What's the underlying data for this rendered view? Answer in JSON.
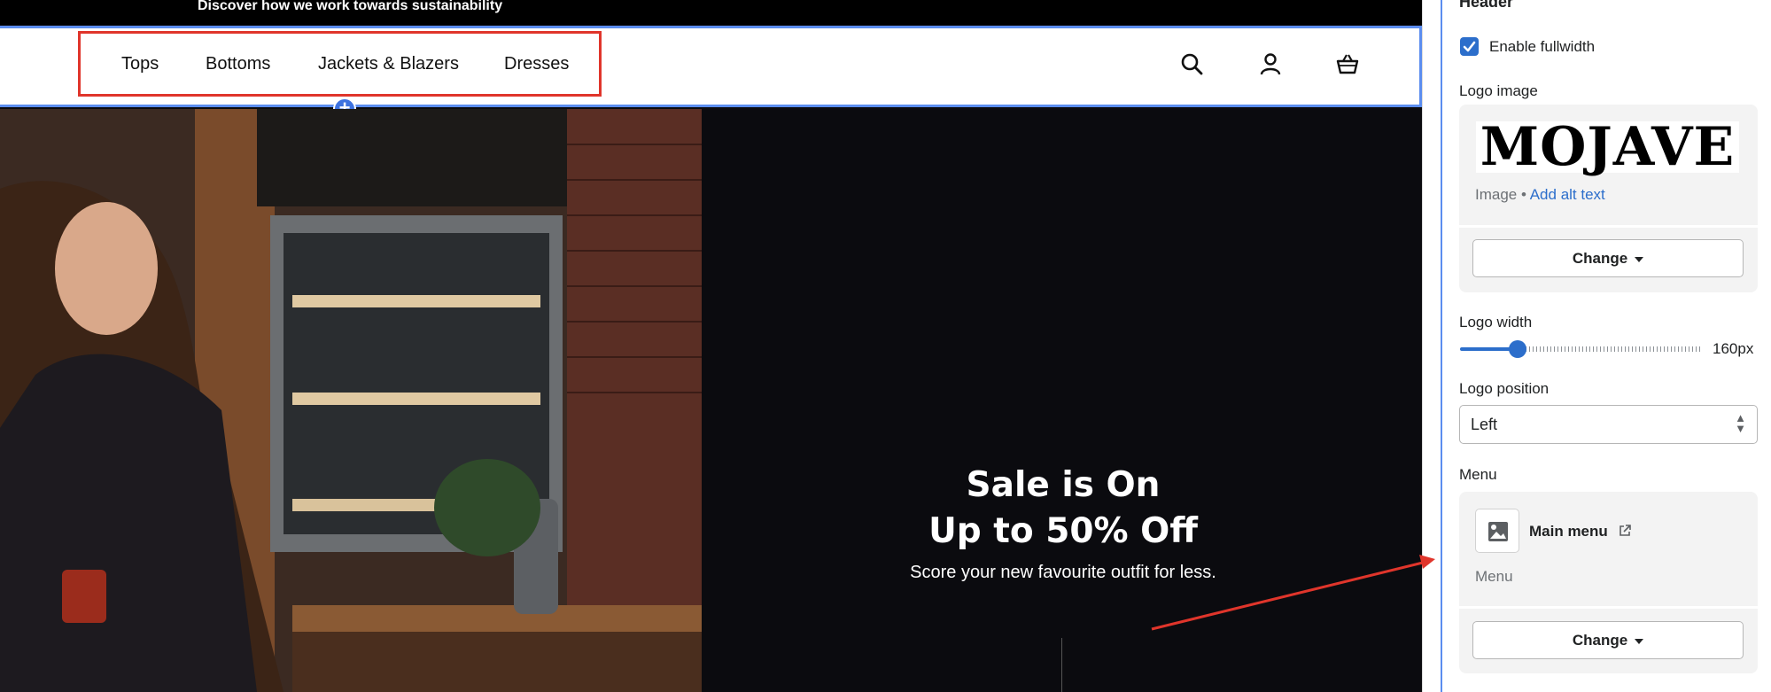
{
  "preview": {
    "announcement": "Discover how we work towards sustainability",
    "nav": [
      "Tops",
      "Bottoms",
      "Jackets & Blazers",
      "Dresses"
    ],
    "header_icons": [
      "search-icon",
      "account-icon",
      "cart-icon"
    ],
    "hero": {
      "line1": "Sale is On",
      "line2": "Up to 50% Off",
      "subtitle": "Score your new favourite outfit for less."
    }
  },
  "panel": {
    "title": "Header",
    "fullwidth": {
      "label": "Enable fullwidth",
      "checked": true
    },
    "logo_image": {
      "label": "Logo image",
      "logo_text": "MOJAVE",
      "meta_prefix": "Image",
      "meta_sep": " • ",
      "alt_link": "Add alt text",
      "change_label": "Change"
    },
    "logo_width": {
      "label": "Logo width",
      "value": "160px",
      "fill_fraction": 0.2
    },
    "logo_position": {
      "label": "Logo position",
      "value": "Left"
    },
    "menu": {
      "label": "Menu",
      "name": "Main menu",
      "type": "Menu",
      "change_label": "Change"
    }
  },
  "colors": {
    "accent": "#2c6ecb",
    "selection_outline": "#5b8def",
    "annotation": "#e0352b"
  }
}
